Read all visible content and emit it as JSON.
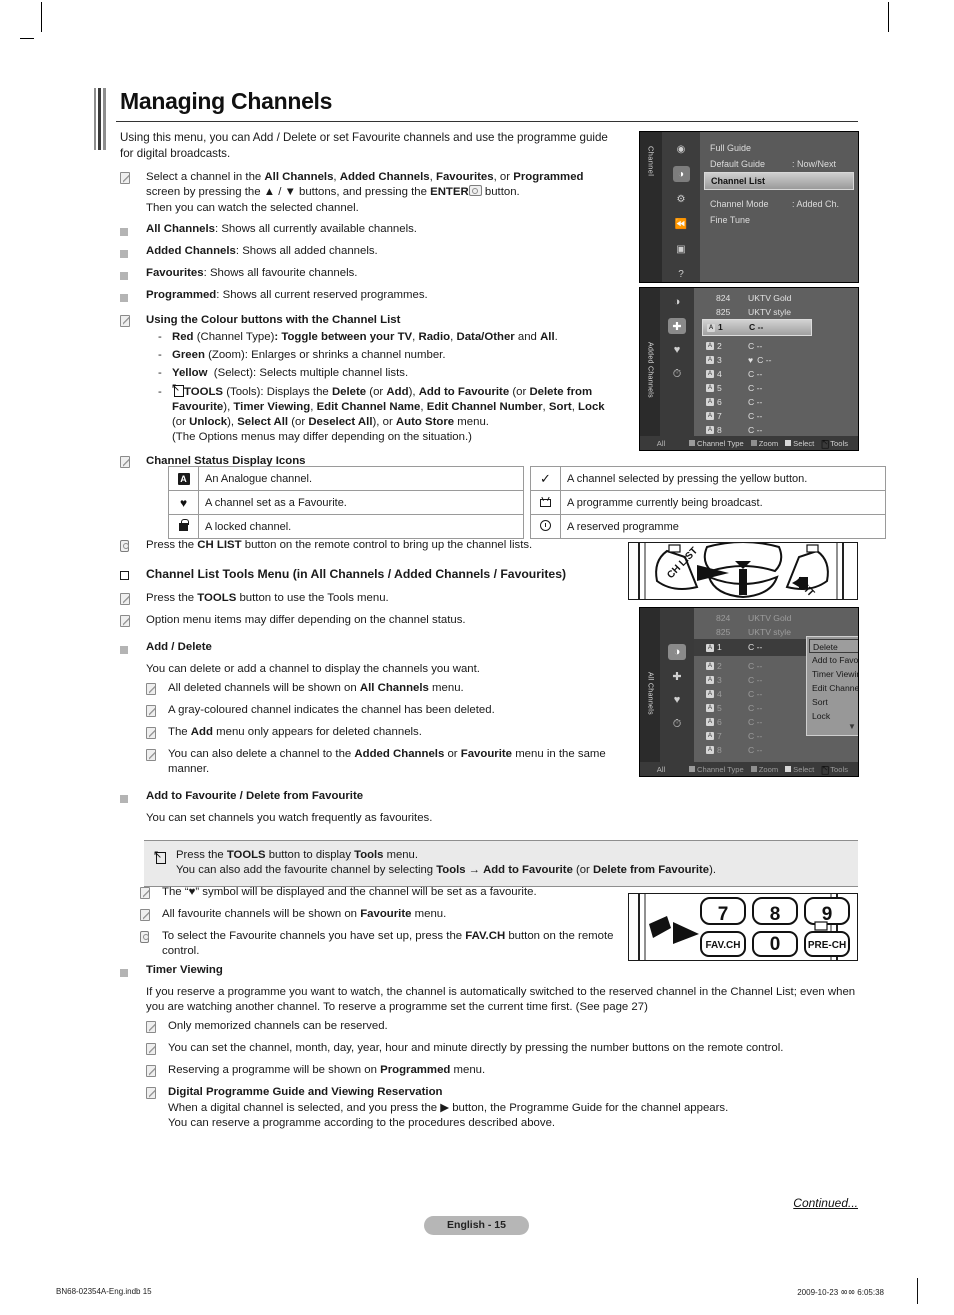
{
  "title": "Managing Channels",
  "intro": "Using this menu, you can Add / Delete or set Favourite channels and use the programme guide for digital broadcasts.",
  "notes": {
    "select_channel_l1_a": "Select a channel in the ",
    "select_channel_all": "All Channels",
    "select_channel_added": "Added Channels",
    "select_channel_fav": "Favourites",
    "select_channel_prog": "Programmed",
    "select_channel_l2": "screen by pressing the ▲ / ▼ buttons, and pressing the ENTER",
    "select_channel_l2b": "button.",
    "select_channel_l3": "Then you can watch the selected channel."
  },
  "list_items": [
    {
      "term": "All Channels",
      "desc": ": Shows all currently available channels."
    },
    {
      "term": "Added Channels",
      "desc": ": Shows all added channels."
    },
    {
      "term": "Favourites",
      "desc": ": Shows all favourite channels."
    },
    {
      "term": "Programmed",
      "desc": ": Shows all current reserved programmes."
    }
  ],
  "colour_buttons": {
    "heading": "Using the Colour buttons with the Channel List",
    "red": {
      "name": "Red",
      "paren": "(Channel Type)",
      "text": ": Toggle between your ",
      "tv": "TV",
      "radio": "Radio",
      "data": "Data/Other",
      "and": " and ",
      "all": "All",
      "end": "."
    },
    "green": {
      "name": "Green",
      "paren": "(Zoom)",
      "text": ": Enlarges or shrinks a channel number."
    },
    "yellow": {
      "name": "Yellow",
      "paren": "(Select)",
      "text": ": Selects multiple channel lists."
    },
    "tools": {
      "name": "TOOLS",
      "paren": "(Tools)",
      "lead": ": Displays the ",
      "items_line1": [
        "Delete",
        "(or ",
        "Add",
        "), ",
        "Add to Favourite",
        " (or ",
        "Delete from"
      ],
      "line2": [
        "Favourite",
        "), ",
        "Timer Viewing",
        ", ",
        "Edit Channel Name",
        ", ",
        "Edit Channel Number",
        ", ",
        "Sort",
        ", ",
        "Lock"
      ],
      "line3": [
        "(or ",
        "Unlock",
        "), ",
        "Select All",
        " (or ",
        "Deselect All",
        "), or ",
        "Auto Store",
        " menu."
      ],
      "line4": "(The Options menus may differ depending on the situation.)"
    }
  },
  "status_icons": {
    "heading": "Channel Status Display Icons",
    "left": [
      {
        "icon": "analogue-A-icon",
        "text": "An Analogue channel."
      },
      {
        "icon": "heart-icon",
        "text": "A channel set as a Favourite."
      },
      {
        "icon": "lock-icon",
        "text": "A locked channel."
      }
    ],
    "right": [
      {
        "icon": "check-icon",
        "text": "A channel selected by pressing the yellow button."
      },
      {
        "icon": "tv-icon",
        "text": "A programme currently being broadcast."
      },
      {
        "icon": "clock-icon",
        "text": "A reserved programme"
      }
    ]
  },
  "ch_list_note": {
    "pre": "Press the ",
    "b": "CH LIST",
    "post": " button on the remote control to bring up the channel lists."
  },
  "tools_menu_section": {
    "heading": "Channel List Tools Menu (in All Channels / Added Channels / Favourites)",
    "note1": {
      "pre": "Press the ",
      "b": "TOOLS",
      "post": " button to use the Tools menu."
    },
    "note2": "Option menu items may differ depending on the channel status."
  },
  "add_delete": {
    "heading": "Add / Delete",
    "desc": "You can delete or add a channel to display the channels you want.",
    "notes": [
      {
        "pre": "All deleted channels will be shown on ",
        "b": "All Channels",
        "post": " menu."
      },
      {
        "pre": "A gray-coloured channel indicates the channel has been deleted.",
        "b": "",
        "post": ""
      },
      {
        "pre": "The ",
        "b": "Add",
        "post": " menu only appears for deleted channels."
      },
      {
        "pre": "You can also delete a channel to the ",
        "b": "Added Channels",
        "mid": " or ",
        "b2": "Favourite",
        "post": " menu in the same manner."
      }
    ]
  },
  "add_favourite": {
    "heading": "Add to Favourite / Delete from Favourite",
    "desc": "You can set channels you watch frequently as favourites."
  },
  "callout": {
    "line1_pre": "Press the ",
    "line1_b": "TOOLS",
    "line1_mid": " button to display ",
    "line1_b2": "Tools",
    "line1_post": " menu.",
    "line2_pre": "You can also add the favourite channel by selecting ",
    "line2_b": "Tools",
    "line2_arrow": " → ",
    "line2_b2": "Add to Favourite",
    "line2_mid": " (or ",
    "line2_b3": "Delete from Favourite",
    "line2_post": ")."
  },
  "fav_notes": [
    {
      "pre": "The “♥” symbol will be displayed and the channel will be set as a favourite.",
      "b": "",
      "post": ""
    },
    {
      "pre": "All favourite channels will be shown on ",
      "b": "Favourite",
      "post": " menu."
    },
    {
      "pre": "To select the Favourite channels you have set up, press the ",
      "b": "FAV.CH",
      "post": " button on the remote control."
    }
  ],
  "timer_viewing": {
    "heading": "Timer Viewing",
    "desc": "If you reserve a programme you want to watch, the channel is automatically switched to the reserved channel in the Channel List; even when you are watching another channel. To reserve a programme set the current time first. (See page 27)",
    "notes": [
      {
        "pre": "Only memorized channels can be reserved.",
        "b": "",
        "post": ""
      },
      {
        "pre": "You can set the channel, month, day, year, hour and minute directly by pressing the number buttons on the remote control.",
        "b": "",
        "post": ""
      },
      {
        "pre": "Reserving a programme will be shown on ",
        "b": "Programmed",
        "post": " menu."
      }
    ],
    "dpg_heading": "Digital Programme Guide and Viewing Reservation",
    "dpg_line1": "When a digital channel is selected, and you press the ▶ button, the Programme Guide for the channel appears.",
    "dpg_line2": "You can reserve a programme  according to the procedures described above."
  },
  "tv_menu": {
    "tab_label": "Channel",
    "rows": [
      {
        "label": "Full Guide",
        "value": ""
      },
      {
        "label": "Default Guide",
        "value": ": Now/Next"
      },
      {
        "label": "Channel List",
        "value": "",
        "selected": true
      },
      {
        "label": "Channel Mode",
        "value": ": Added Ch."
      },
      {
        "label": "Fine Tune",
        "value": ""
      }
    ]
  },
  "tv_added": {
    "tab_label": "Added Channels",
    "header_rows": [
      {
        "num": "824",
        "name": "UKTV Gold"
      },
      {
        "num": "825",
        "name": "UKTV style"
      }
    ],
    "rows": [
      {
        "num": "1",
        "name": "C --",
        "selected": true,
        "fav": false
      },
      {
        "num": "2",
        "name": "C --",
        "selected": false,
        "fav": false
      },
      {
        "num": "3",
        "name": "C --",
        "selected": false,
        "fav": true
      },
      {
        "num": "4",
        "name": "C --",
        "selected": false,
        "fav": false
      },
      {
        "num": "5",
        "name": "C --",
        "selected": false,
        "fav": false
      },
      {
        "num": "6",
        "name": "C --",
        "selected": false,
        "fav": false
      },
      {
        "num": "7",
        "name": "C --",
        "selected": false,
        "fav": false
      },
      {
        "num": "8",
        "name": "C --",
        "selected": false,
        "fav": false
      }
    ],
    "bottom": {
      "all": "All",
      "channel_type": "Channel Type",
      "zoom": "Zoom",
      "select": "Select",
      "tools": "Tools"
    }
  },
  "tv_tools": {
    "tab_label": "All Channels",
    "header_rows": [
      {
        "num": "824",
        "name": "UKTV Gold"
      },
      {
        "num": "825",
        "name": "UKTV style"
      }
    ],
    "rows": [
      {
        "num": "1",
        "name": "C --",
        "selected": true
      },
      {
        "num": "2",
        "name": "C --",
        "selected": false
      },
      {
        "num": "3",
        "name": "C --",
        "selected": false
      },
      {
        "num": "4",
        "name": "C --",
        "selected": false
      },
      {
        "num": "5",
        "name": "C --",
        "selected": false
      },
      {
        "num": "6",
        "name": "C --",
        "selected": false
      },
      {
        "num": "7",
        "name": "C --",
        "selected": false
      },
      {
        "num": "8",
        "name": "C --",
        "selected": false
      }
    ],
    "popup": [
      "Delete",
      "Add to Favourite",
      "Timer Viewing",
      "Edit Channel Name",
      "Sort",
      "Lock"
    ],
    "bottom": {
      "all": "All",
      "channel_type": "Channel Type",
      "zoom": "Zoom",
      "select": "Select",
      "tools": "Tools"
    }
  },
  "remote_top": {
    "ch_list": "CH LIST",
    "exit": "EXIT"
  },
  "remote_bottom": {
    "k7": "7",
    "k8": "8",
    "k9": "9",
    "fav": "FAV.CH",
    "k0": "0",
    "prech": "PRE-CH"
  },
  "footer": {
    "page_label": "English - 15",
    "continued": "Continued...",
    "file": "BN68-02354A-Eng.indb   15",
    "date": "2009-10-23   ㆀㆀ 6:05:38"
  }
}
